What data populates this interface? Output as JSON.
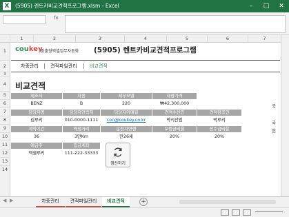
{
  "window": {
    "title": "(5905) 렌트카비교견적프로그램.xlsm - Excel"
  },
  "formula_bar": {
    "fx": "fx"
  },
  "columns": [
    "1",
    "2",
    "3",
    "4",
    "5",
    "6",
    "7"
  ],
  "rows": [
    "1",
    "2",
    "3",
    "4",
    "5",
    "6",
    "7",
    "8",
    "9",
    "10",
    "11",
    "12",
    "13",
    "14"
  ],
  "banner": {
    "logo_main": "cou",
    "logo_accent": "key",
    "logo_sub": "맞춤형엑셀업무자동화",
    "title": "(5905)  렌트카비교견적프로그램"
  },
  "nav": {
    "items": [
      "차종관리",
      "견적파일관리",
      "비교견적"
    ]
  },
  "page_title": "비교견적",
  "table": {
    "header1": [
      "제조사",
      "차종",
      "세부모델",
      "차량가격"
    ],
    "values1": [
      "BENZ",
      "B",
      "220",
      "₩42,300,000"
    ],
    "header2": [
      "담당자명",
      "담당자연락처",
      "담당자이메일",
      "견적수신인",
      "견적참조인"
    ],
    "values2": [
      "김루키",
      "010-0000-1111",
      "con@coukey.co.kr",
      "락키산업",
      "박루키"
    ],
    "header3": [
      "계약기간",
      "약정거리",
      "운전자연령",
      "보증금비율",
      "선수금비율"
    ],
    "values3": [
      "36",
      "3만Km",
      "만26세",
      "20%",
      "20%"
    ],
    "header4": [
      "예금주",
      "입금계좌"
    ],
    "values4": [
      "엑셀루키",
      "111-222-33333"
    ]
  },
  "refresh_button": {
    "label": "갱신하기"
  },
  "right_edge": [
    "국",
    "국",
    "현"
  ],
  "sheet_tabs": [
    "차종관리",
    "견적파일관리",
    "비교견적"
  ],
  "active_tab": "비교견적",
  "status": {
    "ready": ""
  }
}
